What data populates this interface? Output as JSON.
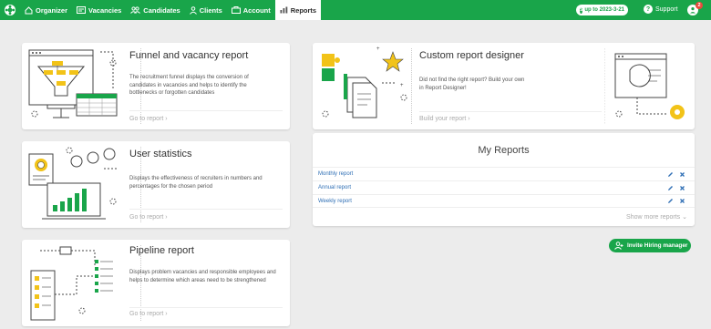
{
  "nav": {
    "items": [
      {
        "label": "Organizer",
        "icon": "home-icon"
      },
      {
        "label": "Vacancies",
        "icon": "vacancies-icon"
      },
      {
        "label": "Candidates",
        "icon": "candidates-icon"
      },
      {
        "label": "Clients",
        "icon": "clients-icon"
      },
      {
        "label": "Account",
        "icon": "account-icon"
      },
      {
        "label": "Reports",
        "icon": "reports-icon",
        "active": true
      }
    ],
    "subscription": "up to 2023-3-21",
    "support": "Support",
    "notifications": "2"
  },
  "cards": {
    "funnel": {
      "title": "Funnel and vacancy report",
      "description": "The recruitment funnel displays the conversion of candidates in vacancies and helps to identify the bottlenecks or forgotten candidates",
      "link": "Go to report ›"
    },
    "user_stats": {
      "title": "User statistics",
      "description": "Displays the effectiveness of recruiters in numbers and percentages for the chosen period",
      "link": "Go to report ›"
    },
    "pipeline": {
      "title": "Pipeline report",
      "description": "Displays problem vacancies and responsible employees and helps to determine which areas need to be strengthened",
      "link": "Go to report ›"
    },
    "custom": {
      "title": "Custom report designer",
      "description": "Did not find the right report? Build your own in Report Designer!",
      "link": "Build your report ›"
    }
  },
  "my_reports": {
    "title": "My Reports",
    "items": [
      "Monthly report",
      "Annual report",
      "Weekly report"
    ],
    "show_more": "Show more reports ⌄"
  },
  "invite": "Invite Hiring manager",
  "colors": {
    "brand_green": "#19a54a",
    "link_blue": "#2f6fb5",
    "accent_yellow": "#f2c318"
  }
}
